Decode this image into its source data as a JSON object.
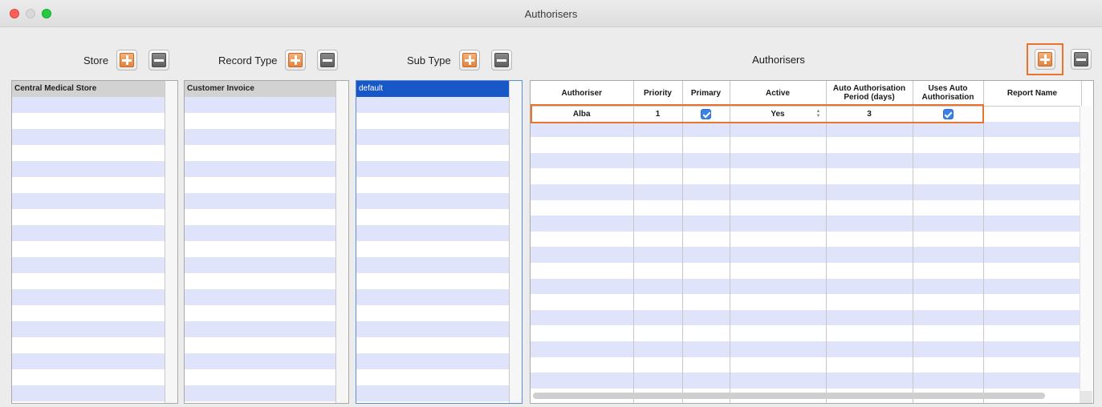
{
  "window": {
    "title": "Authorisers"
  },
  "store": {
    "label": "Store",
    "items": [
      "Central Medical Store"
    ]
  },
  "record_type": {
    "label": "Record Type",
    "items": [
      "Customer Invoice"
    ]
  },
  "sub_type": {
    "label": "Sub Type",
    "items": [
      "default"
    ]
  },
  "authorisers": {
    "title": "Authorisers",
    "columns": [
      "Authoriser",
      "Priority",
      "Primary",
      "Active",
      "Auto Authorisation Period  (days)",
      "Uses Auto Authorisation",
      "Report Name"
    ],
    "rows": [
      {
        "authoriser": "Alba",
        "priority": "1",
        "primary": true,
        "active": "Yes",
        "auto_period": "3",
        "uses_auto": true,
        "report_name": ""
      }
    ]
  },
  "colors": {
    "highlight": "#e8742f",
    "selection": "#1757c8",
    "stripe": "#e0e4fb"
  }
}
